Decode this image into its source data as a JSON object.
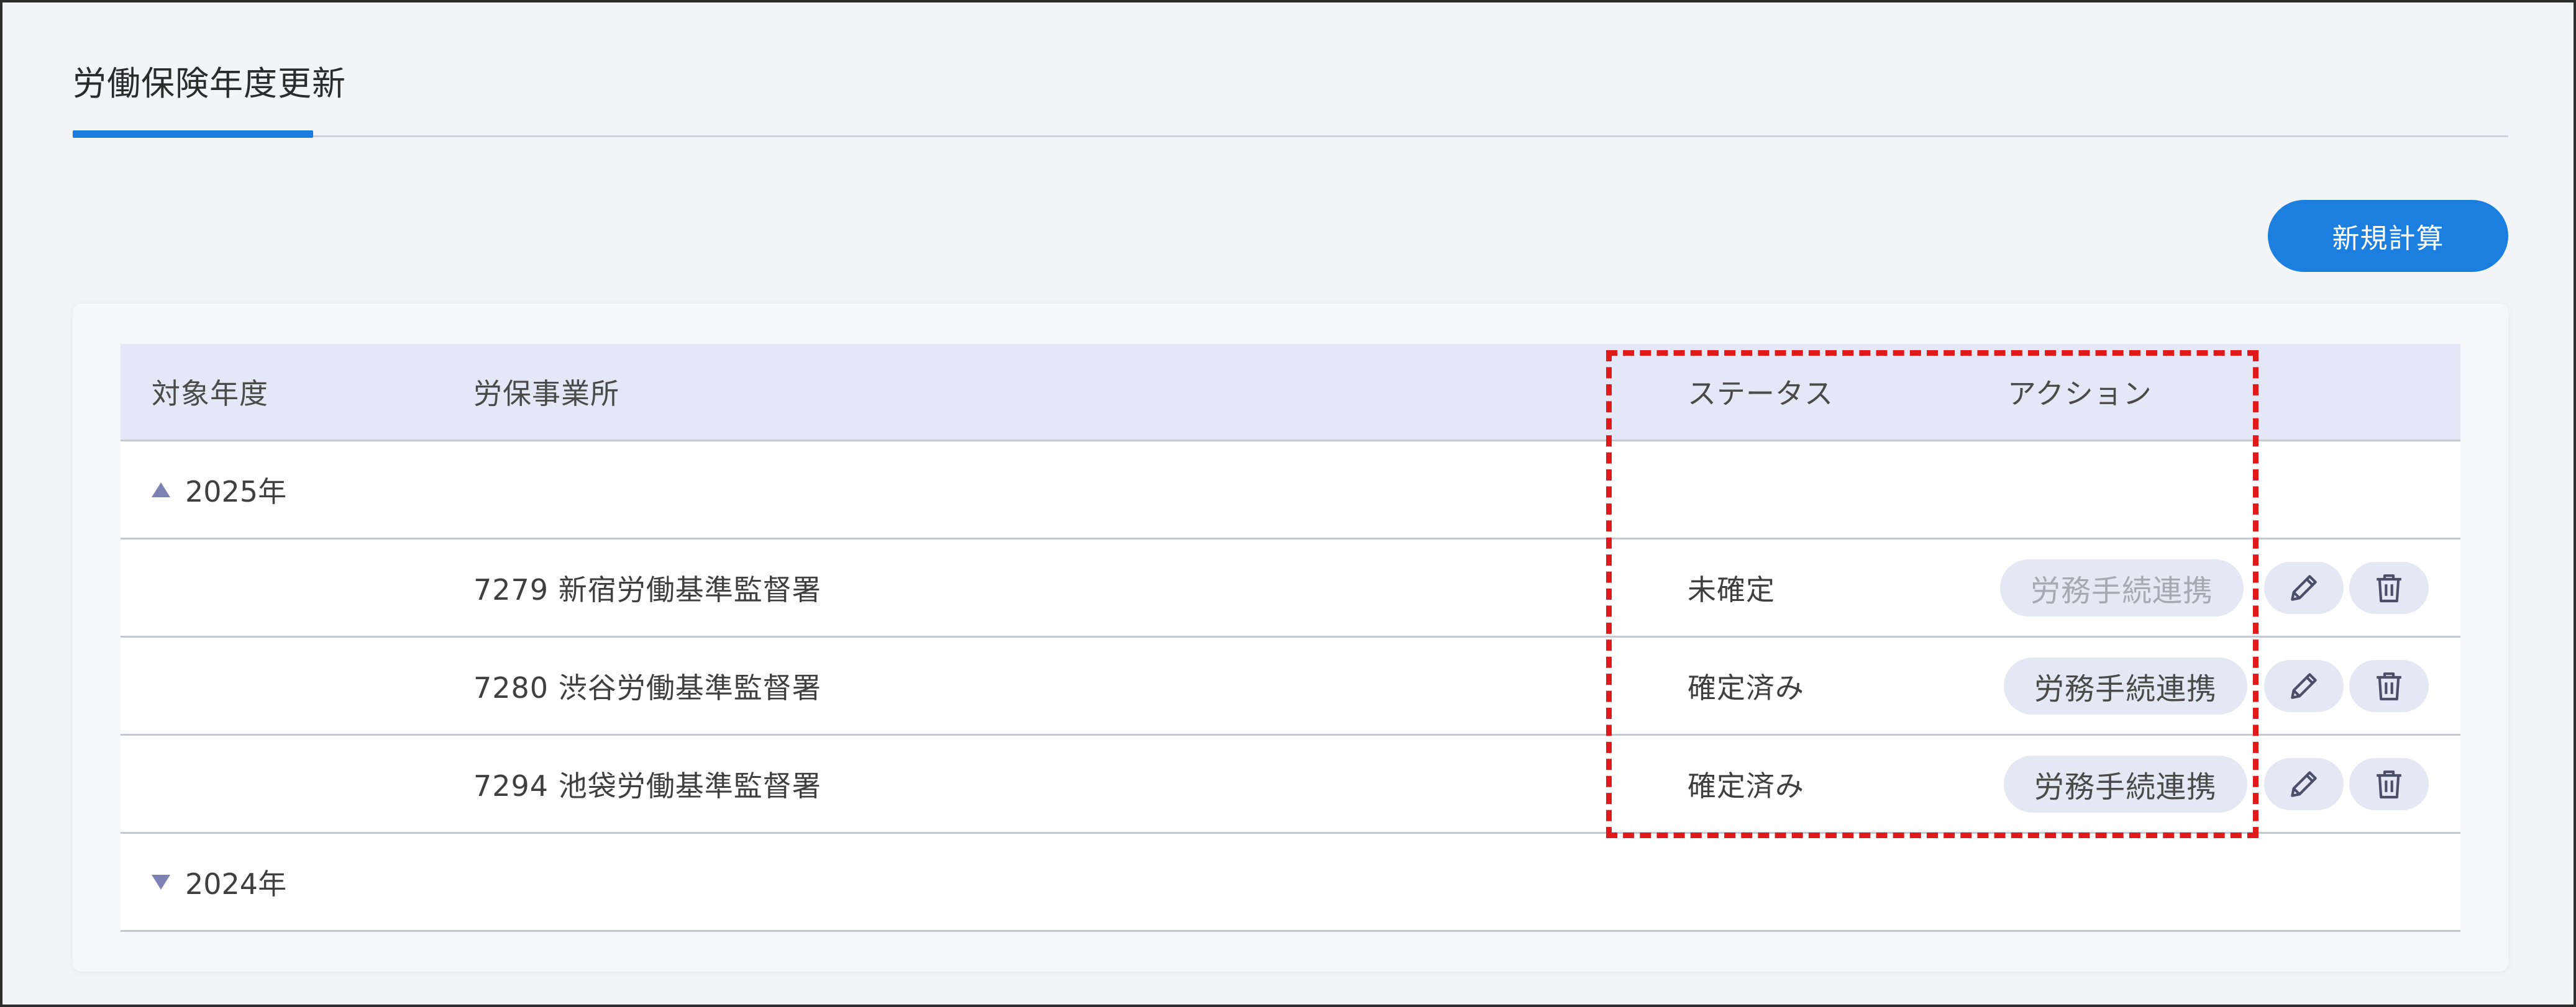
{
  "header": {
    "title": "労働保険年度更新"
  },
  "toolbar": {
    "new_label": "新規計算"
  },
  "table": {
    "columns": [
      "対象年度",
      "労保事業所",
      "ステータス",
      "アクション"
    ],
    "groups": [
      {
        "year": "2025年",
        "expanded": true,
        "rows": [
          {
            "office": "7279 新宿労働基準監督署",
            "status": "未確定",
            "action": "労務手続連携",
            "action_enabled": false
          },
          {
            "office": "7280 渋谷労働基準監督署",
            "status": "確定済み",
            "action": "労務手続連携",
            "action_enabled": true
          },
          {
            "office": "7294 池袋労働基準監督署",
            "status": "確定済み",
            "action": "労務手続連携",
            "action_enabled": true
          }
        ]
      },
      {
        "year": "2024年",
        "expanded": false,
        "rows": []
      }
    ]
  },
  "icons": {
    "expand_open": "triangle-up-icon",
    "expand_closed": "triangle-down-icon",
    "edit": "pencil-icon",
    "delete": "trash-icon"
  },
  "colors": {
    "accent": "#1c7fe0",
    "header_bg": "#e4e7f5",
    "highlight": "#e01a1a",
    "toggle": "#7d82b4"
  }
}
